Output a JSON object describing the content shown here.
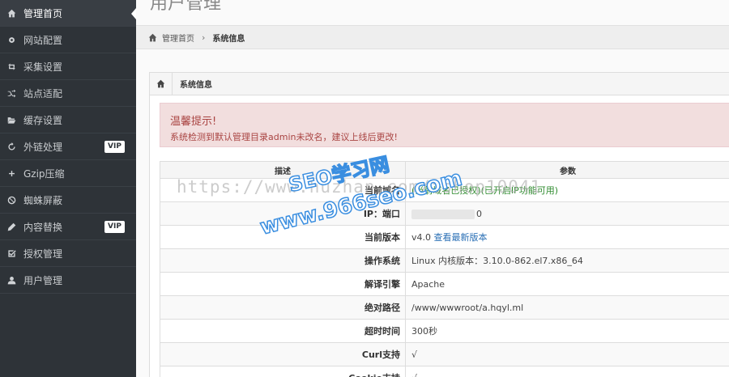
{
  "sidebar": {
    "items": [
      {
        "label": "管理首页",
        "icon": "home-icon"
      },
      {
        "label": "网站配置",
        "icon": "gear-icon"
      },
      {
        "label": "采集设置",
        "icon": "retweet-icon"
      },
      {
        "label": "站点适配",
        "icon": "shuffle-icon"
      },
      {
        "label": "缓存设置",
        "icon": "folder-open-icon"
      },
      {
        "label": "外链处理",
        "icon": "refresh-icon",
        "badge": "VIP"
      },
      {
        "label": "Gzip压缩",
        "icon": "compress-icon"
      },
      {
        "label": "蜘蛛屏蔽",
        "icon": "ban-icon"
      },
      {
        "label": "内容替换",
        "icon": "pencil-icon",
        "badge": "VIP"
      },
      {
        "label": "授权管理",
        "icon": "check-square-icon"
      },
      {
        "label": "用户管理",
        "icon": "user-icon"
      }
    ]
  },
  "page_title": "用户管理",
  "breadcrumb": {
    "home": "管理首页",
    "current": "系统信息"
  },
  "panel": {
    "title": "系统信息"
  },
  "alert": {
    "title": "温馨提示!",
    "message": "系统检测到默认管理目录admin未改名，建议上线后更改!"
  },
  "table": {
    "headers": [
      "描述",
      "参数"
    ],
    "rows": [
      {
        "key": "当前域名",
        "value": "(当前域名已授权)(已开启IP功能可用)"
      },
      {
        "key": "IP：端口",
        "value": "0"
      },
      {
        "key": "当前版本",
        "value": "v4.0",
        "link": "查看最新版本"
      },
      {
        "key": "操作系统",
        "value": "Linux  内核版本：3.10.0-862.el7.x86_64"
      },
      {
        "key": "解译引擎",
        "value": "Apache"
      },
      {
        "key": "绝对路径",
        "value": "/www/wwwroot/a.hqyl.ml"
      },
      {
        "key": "超时时间",
        "value": "300秒"
      },
      {
        "key": "Curl支持",
        "value": "√"
      },
      {
        "key": "Cookie支持",
        "value": "√"
      }
    ]
  },
  "watermarks": {
    "url": "https://www.huzhan.com/ishop10041",
    "seo": "SEO学习网",
    "site": "www.966seo.com"
  }
}
